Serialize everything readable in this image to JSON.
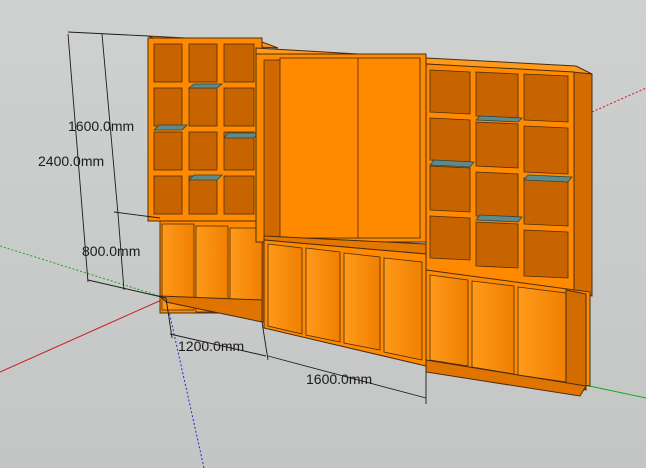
{
  "viewport": {
    "background": "#c9cbcb",
    "wood_color": "#ff8a00",
    "wood_dark": "#d96f00",
    "wood_interior": "#c86400",
    "glass_color": "#5e8a8a",
    "edge_color": "#4a2d10"
  },
  "axes": {
    "red": "#c81e1e",
    "green": "#1aa51a",
    "blue": "#2828d0"
  },
  "dimensions": {
    "total_height": "2400.0mm",
    "upper_height": "1600.0mm",
    "lower_height": "800.0mm",
    "left_width": "1200.0mm",
    "middle_width": "1600.0mm"
  }
}
